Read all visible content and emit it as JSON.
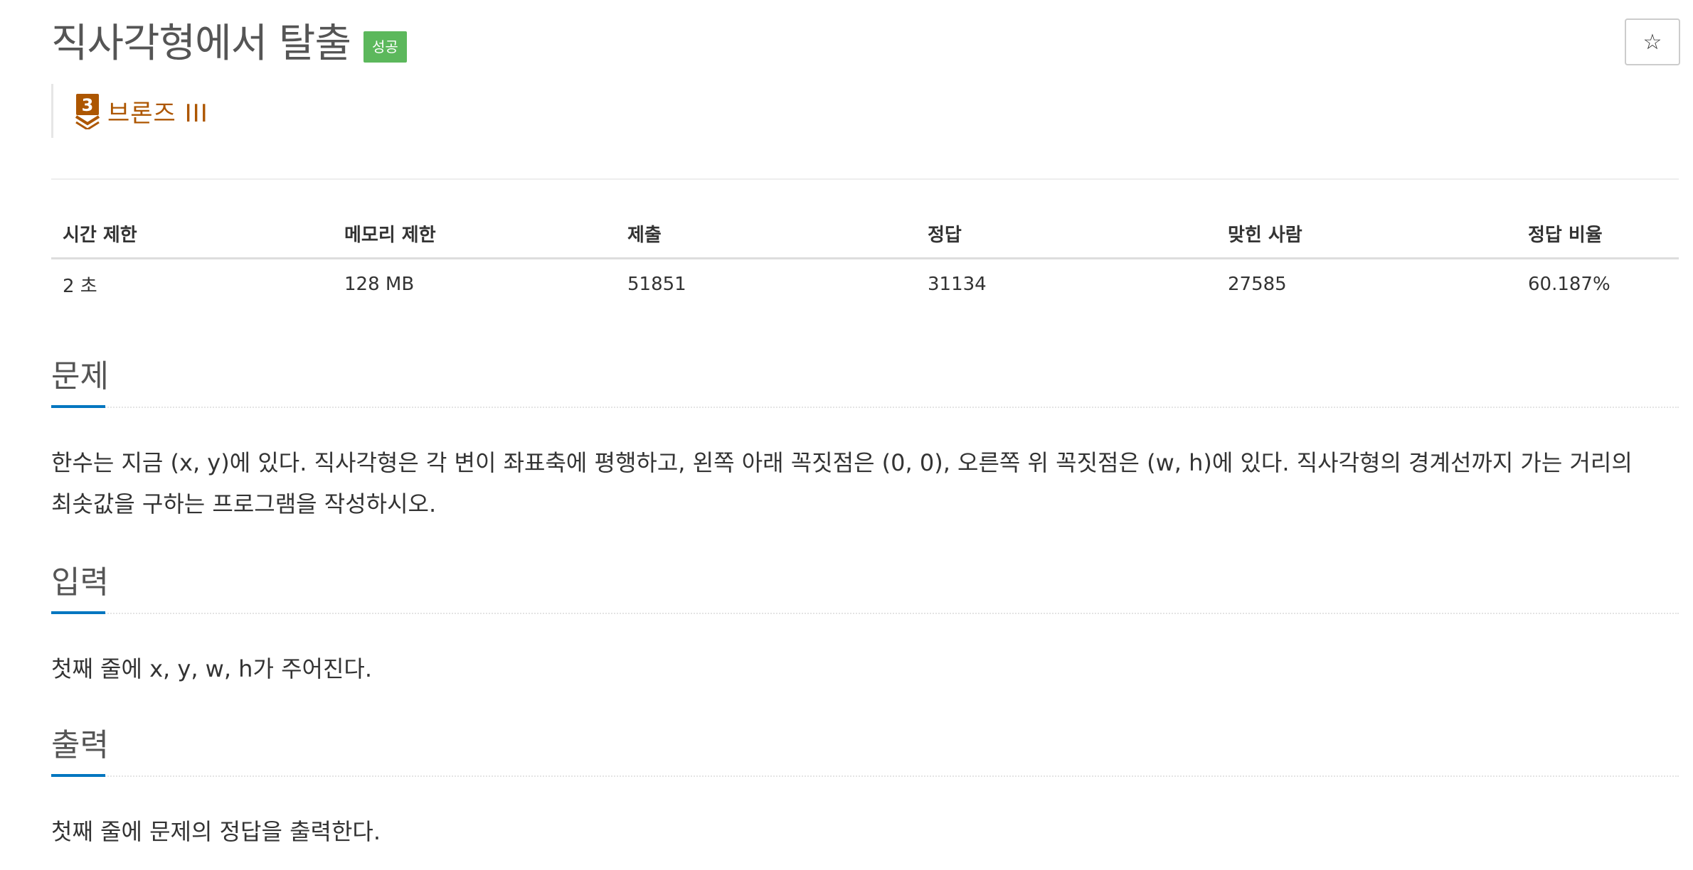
{
  "problem": {
    "title": "직사각형에서 탈출",
    "status_badge": "성공",
    "tier_number": "3",
    "tier_name": "브론즈 III",
    "star_icon": "star-outline-icon"
  },
  "info_table": {
    "headers": [
      "시간 제한",
      "메모리 제한",
      "제출",
      "정답",
      "맞힌 사람",
      "정답 비율"
    ],
    "values": [
      "2 초",
      "128 MB",
      "51851",
      "31134",
      "27585",
      "60.187%"
    ]
  },
  "sections": {
    "problem": {
      "title": "문제",
      "body": "한수는 지금 (x, y)에 있다. 직사각형은 각 변이 좌표축에 평행하고, 왼쪽 아래 꼭짓점은 (0, 0), 오른쪽 위 꼭짓점은 (w, h)에 있다. 직사각형의 경계선까지 가는 거리의 최솟값을 구하는 프로그램을 작성하시오."
    },
    "input": {
      "title": "입력",
      "body": "첫째 줄에 x, y, w, h가 주어진다."
    },
    "output": {
      "title": "출력",
      "body": "첫째 줄에 문제의 정답을 출력한다."
    }
  },
  "colors": {
    "badge_success": "#5cb85c",
    "tier_bronze": "#ad5600",
    "section_accent": "#0076c0"
  }
}
